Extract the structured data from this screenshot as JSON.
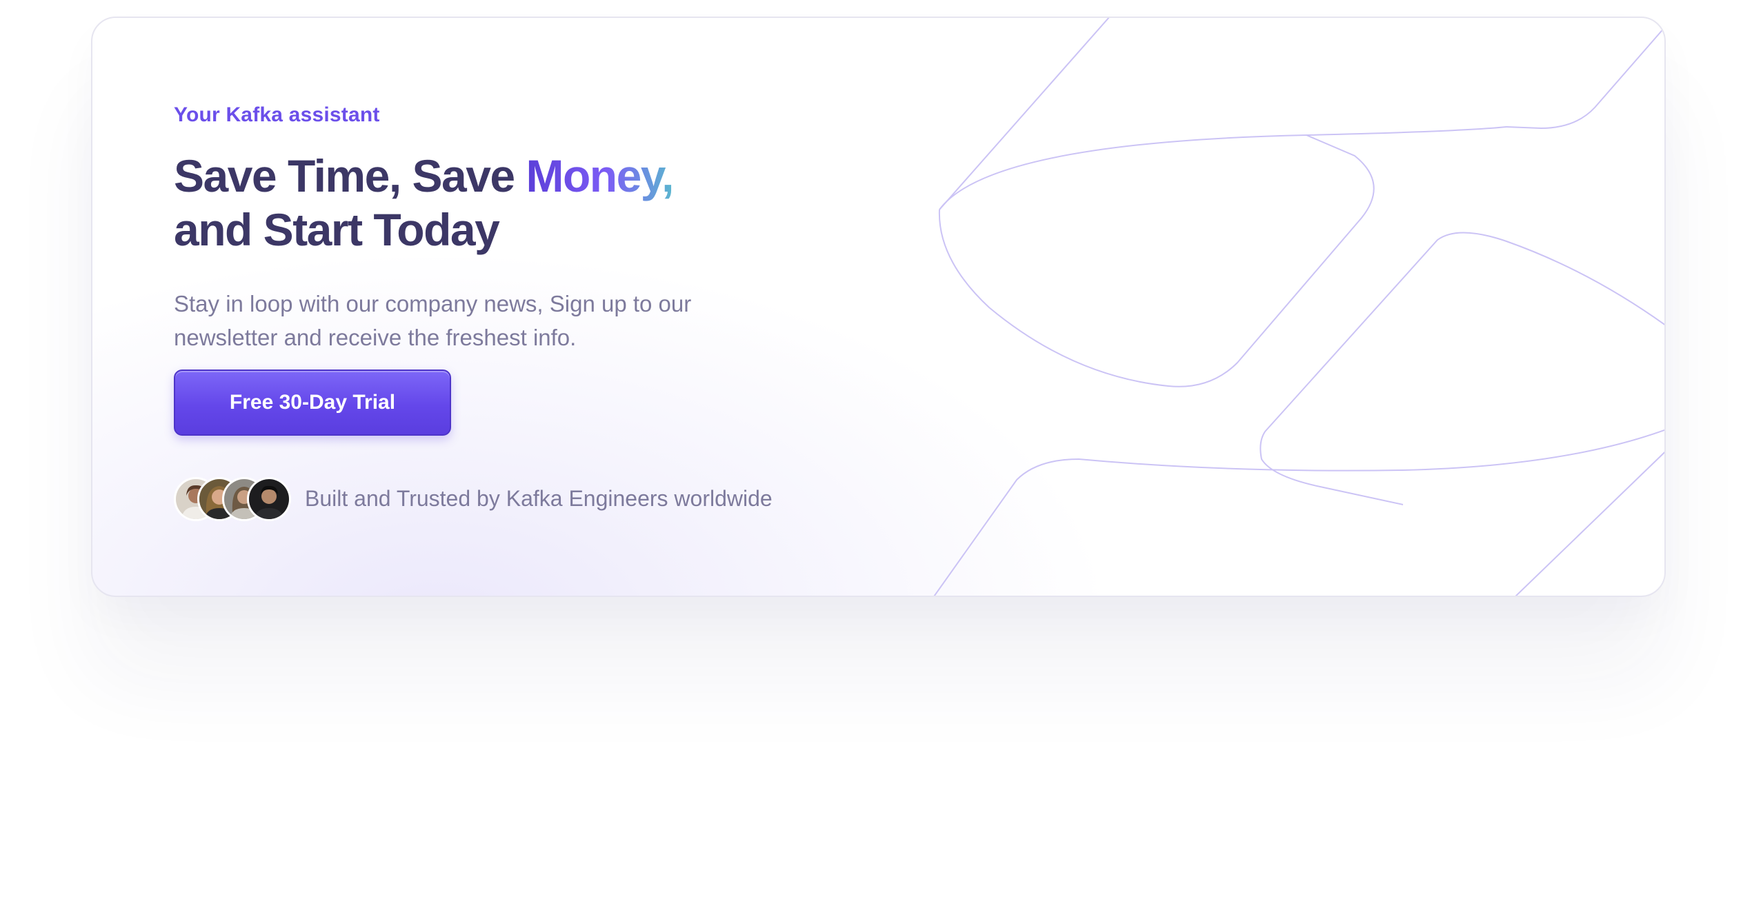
{
  "banner": {
    "eyebrow": "Your Kafka assistant",
    "headline": {
      "line1_prefix": "Save Time, Save ",
      "line1_accent": "Money,",
      "line2": "and Start Today"
    },
    "subtext": "Stay in loop with our company news, Sign up to our newsletter and receive the freshest info.",
    "cta_label": "Free 30-Day Trial",
    "trust_text": "Built and Trusted by Kafka Engineers worldwide",
    "avatars": [
      "avatar-1",
      "avatar-2",
      "avatar-3",
      "avatar-4"
    ]
  },
  "colors": {
    "accent": "#6b4fea",
    "headline": "#3c3766",
    "body_text": "#7d7a9c",
    "button": "#6447ea",
    "line_art": "#cbc3f5"
  }
}
